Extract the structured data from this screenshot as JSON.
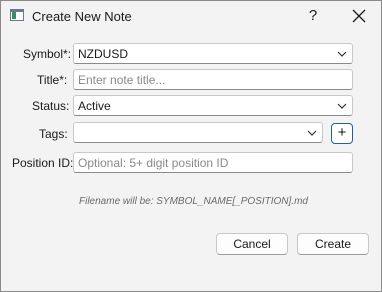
{
  "window": {
    "title": "Create New Note",
    "help_label": "?",
    "icons": {
      "app": "app-icon",
      "close": "close-icon"
    }
  },
  "form": {
    "symbol": {
      "label": "Symbol*:",
      "value": "NZDUSD"
    },
    "title": {
      "label": "Title*:",
      "placeholder": "Enter note title..."
    },
    "status": {
      "label": "Status:",
      "value": "Active"
    },
    "tags": {
      "label": "Tags:",
      "value": "",
      "add_label": "+"
    },
    "position_id": {
      "label": "Position ID:",
      "placeholder": "Optional: 5+ digit position ID"
    }
  },
  "hint": "Filename will be: SYMBOL_NAME[_POSITION].md",
  "buttons": {
    "cancel": "Cancel",
    "create": "Create"
  }
}
